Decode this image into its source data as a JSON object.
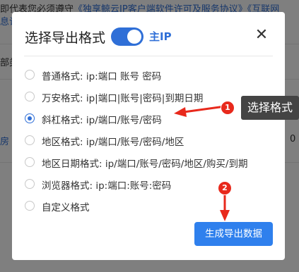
{
  "background": {
    "notice_line1_prefix": "即代表您必须遵守",
    "notice_link1": "《独享鲸云IP客户端软件许可及服务协议》",
    "notice_link2": "《互联网",
    "notice_line2": "息许",
    "left_text_a": "部类",
    "left_text_b": "房",
    "right_value": "0"
  },
  "dialog": {
    "title": "选择导出格式",
    "toggle_label": "主IP",
    "toggle_on": true,
    "close_icon": "close-icon",
    "options": [
      {
        "label": "普通格式: ip:端口 账号 密码",
        "checked": false
      },
      {
        "label": "万安格式: ip|端口|账号|密码|到期日期",
        "checked": false
      },
      {
        "label": "斜杠格式: ip/端口/账号/密码",
        "checked": true
      },
      {
        "label": "地区格式: ip/端口/账号/密码/地区",
        "checked": false
      },
      {
        "label": "地区日期格式: ip/端口/账号/密码/地区/购买/到期",
        "checked": false
      },
      {
        "label": "浏览器格式: ip:端口:账号:密码",
        "checked": false
      },
      {
        "label": "自定义格式",
        "checked": false
      }
    ],
    "generate_button": "生成导出数据"
  },
  "annotations": {
    "badge1": "1",
    "badge2": "2",
    "callout": "选择格式",
    "color": "#e8291c"
  }
}
